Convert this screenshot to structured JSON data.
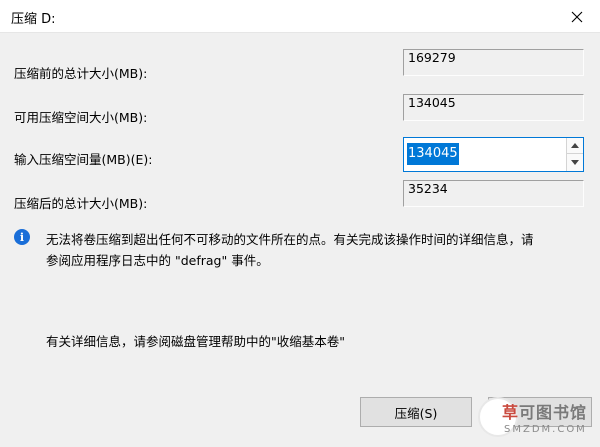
{
  "window": {
    "title": "压缩 D:"
  },
  "fields": {
    "total_before": {
      "label": "压缩前的总计大小(MB):",
      "value": "169279"
    },
    "available": {
      "label": "可用压缩空间大小(MB):",
      "value": "134045"
    },
    "input_amount": {
      "label": "输入压缩空间量(MB)(E):",
      "value": "134045"
    },
    "total_after": {
      "label": "压缩后的总计大小(MB):",
      "value": "35234"
    }
  },
  "info": {
    "icon": "info-icon",
    "line1": "无法将卷压缩到超出任何不可移动的文件所在的点。有关完成该操作时间的详细信息，请",
    "line2": "参阅应用程序日志中的 \"defrag\" 事件。"
  },
  "help": {
    "text": "有关详细信息，请参阅磁盘管理帮助中的\"收缩基本卷\""
  },
  "buttons": {
    "compress": "压缩(S)"
  },
  "watermark": {
    "title_accent": "草",
    "title_rest": "可图书馆",
    "subtitle": "SMZDM.COM"
  },
  "colors": {
    "accent": "#0078d7",
    "info": "#1a6ed8",
    "dialog_bg": "#f0f0f0"
  }
}
